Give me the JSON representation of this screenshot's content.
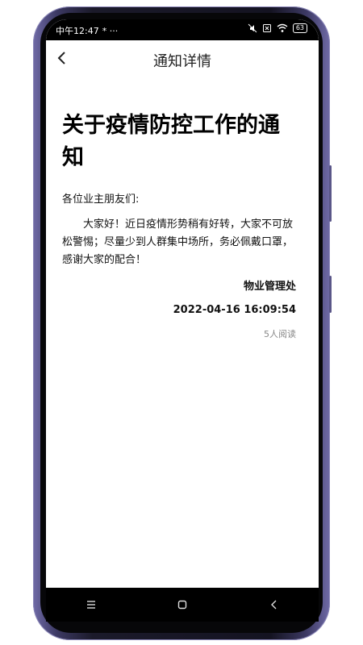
{
  "status_bar": {
    "time": "中午12:47",
    "extra_left": "* ···",
    "battery": "63"
  },
  "header": {
    "title": "通知详情",
    "back_icon": "chevron-left-icon"
  },
  "notice": {
    "title": "关于疫情防控工作的通知",
    "greeting": "各位业主朋友们:",
    "body": "大家好！近日疫情形势稍有好转，大家不可放松警惕；尽量少到人群集中场所，务必佩戴口罩，感谢大家的配合！",
    "sender": "物业管理处",
    "timestamp": "2022-04-16 16:09:54",
    "read_count": "5人阅读"
  },
  "system_nav": {
    "icons": [
      "menu-icon",
      "home-icon",
      "back-icon"
    ]
  }
}
